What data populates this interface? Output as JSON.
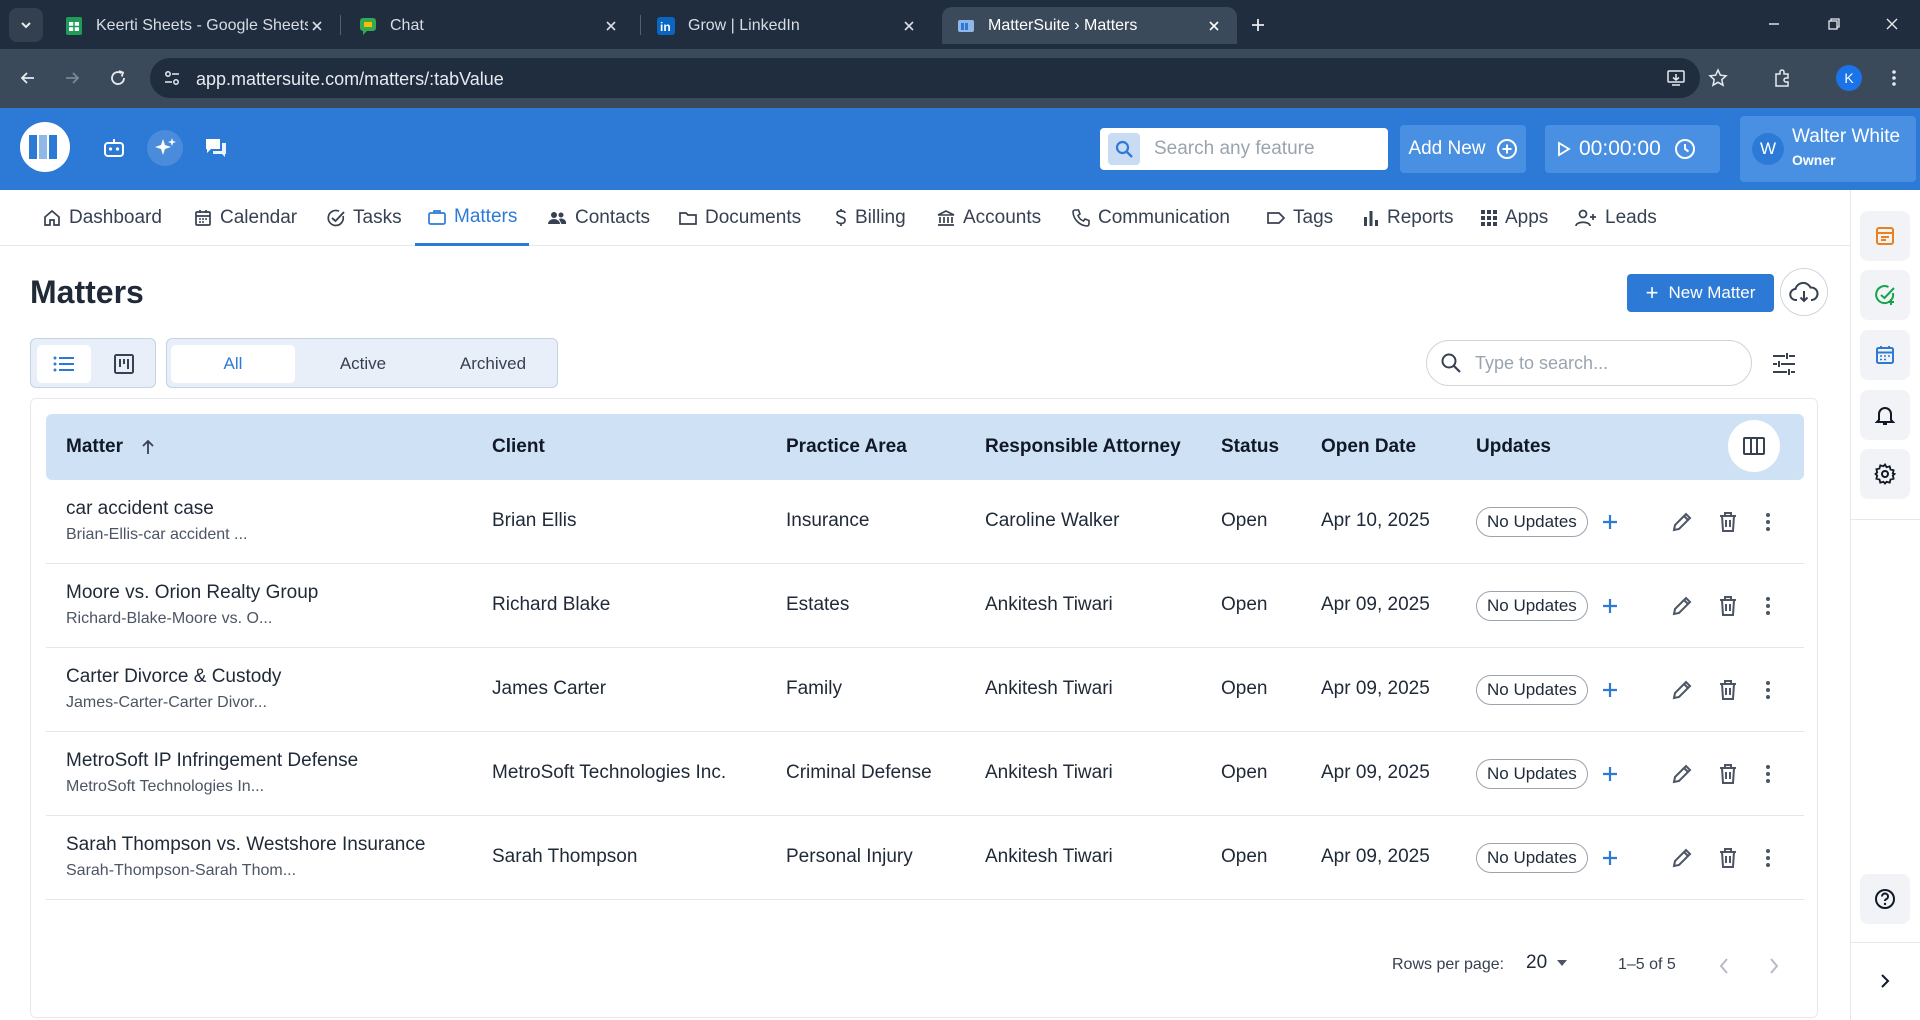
{
  "browser": {
    "tabs": [
      {
        "title": "Keerti Sheets - Google Sheets",
        "icon": "google-sheets-icon"
      },
      {
        "title": "Chat",
        "icon": "google-chat-icon"
      },
      {
        "title": "Grow | LinkedIn",
        "icon": "linkedin-icon"
      },
      {
        "title": "MatterSuite › Matters",
        "icon": "mattersuite-icon",
        "active": true
      }
    ],
    "url": "app.mattersuite.com/matters/:tabValue",
    "profile_initial": "K"
  },
  "header": {
    "search_placeholder": "Search any feature",
    "add_new_label": "Add New",
    "timer_value": "00:00:00",
    "user_initial": "W",
    "user_name": "Walter White",
    "user_role": "Owner"
  },
  "nav": {
    "items": [
      {
        "label": "Dashboard",
        "icon": "home-icon"
      },
      {
        "label": "Calendar",
        "icon": "calendar-icon"
      },
      {
        "label": "Tasks",
        "icon": "task-check-icon"
      },
      {
        "label": "Matters",
        "icon": "briefcase-icon",
        "active": true
      },
      {
        "label": "Contacts",
        "icon": "people-icon"
      },
      {
        "label": "Documents",
        "icon": "folder-icon"
      },
      {
        "label": "Billing",
        "icon": "dollar-icon"
      },
      {
        "label": "Accounts",
        "icon": "bank-icon"
      },
      {
        "label": "Communication",
        "icon": "phone-icon"
      },
      {
        "label": "Tags",
        "icon": "tag-icon"
      },
      {
        "label": "Reports",
        "icon": "bar-chart-icon"
      },
      {
        "label": "Apps",
        "icon": "apps-grid-icon"
      },
      {
        "label": "Leads",
        "icon": "add-person-icon"
      }
    ]
  },
  "page": {
    "title": "Matters",
    "new_matter_label": "New Matter",
    "filter_tabs": [
      {
        "label": "All",
        "active": true
      },
      {
        "label": "Active"
      },
      {
        "label": "Archived"
      }
    ],
    "search_placeholder": "Type to search..."
  },
  "table": {
    "columns": [
      "Matter",
      "Client",
      "Practice Area",
      "Responsible Attorney",
      "Status",
      "Open Date",
      "Updates"
    ],
    "rows": [
      {
        "matter": "car accident case",
        "matter_sub": "Brian-Ellis-car accident ...",
        "client": "Brian Ellis",
        "practice_area": "Insurance",
        "attorney": "Caroline Walker",
        "status": "Open",
        "open_date": "Apr 10, 2025",
        "updates": "No Updates"
      },
      {
        "matter": "Moore vs. Orion Realty Group",
        "matter_sub": "Richard-Blake-Moore vs. O...",
        "client": "Richard Blake",
        "practice_area": "Estates",
        "attorney": "Ankitesh Tiwari",
        "status": "Open",
        "open_date": "Apr 09, 2025",
        "updates": "No Updates"
      },
      {
        "matter": "Carter Divorce & Custody",
        "matter_sub": "James-Carter-Carter Divor...",
        "client": "James Carter",
        "practice_area": "Family",
        "attorney": "Ankitesh Tiwari",
        "status": "Open",
        "open_date": "Apr 09, 2025",
        "updates": "No Updates"
      },
      {
        "matter": "MetroSoft IP Infringement Defense",
        "matter_sub": "MetroSoft Technologies In...",
        "client": "MetroSoft Technologies Inc.",
        "practice_area": "Criminal Defense",
        "attorney": "Ankitesh Tiwari",
        "status": "Open",
        "open_date": "Apr 09, 2025",
        "updates": "No Updates"
      },
      {
        "matter": "Sarah Thompson vs. Westshore Insurance",
        "matter_sub": "Sarah-Thompson-Sarah Thom...",
        "client": "Sarah Thompson",
        "practice_area": "Personal Injury",
        "attorney": "Ankitesh Tiwari",
        "status": "Open",
        "open_date": "Apr 09, 2025",
        "updates": "No Updates"
      }
    ]
  },
  "pagination": {
    "rows_per_page_label": "Rows per page:",
    "rows_per_page": "20",
    "range": "1–5 of 5"
  },
  "colors": {
    "brand_blue": "#2d7ad6",
    "header_button": "#4a90e2",
    "table_header": "#cfe2f5",
    "chrome_dark": "#1f2d3f"
  }
}
